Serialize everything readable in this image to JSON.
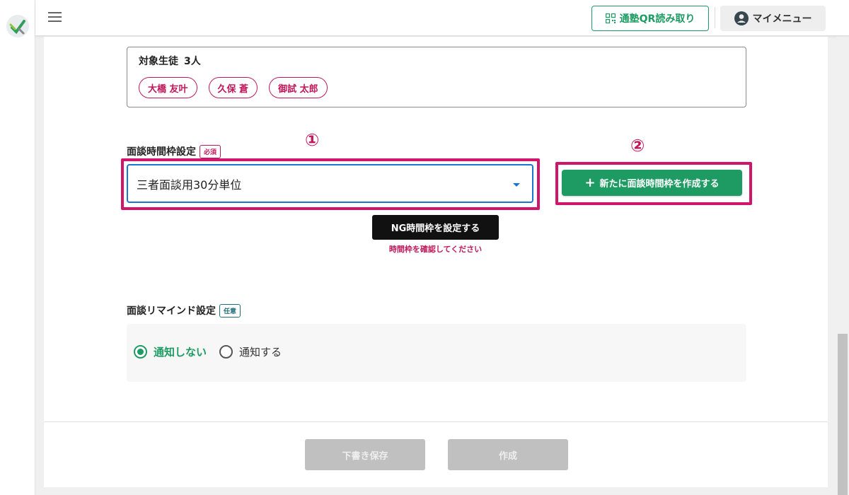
{
  "header": {
    "qr_button_label": "通塾QR読み取り",
    "my_menu_label": "マイメニュー"
  },
  "students": {
    "title": "対象生徒",
    "count": "3人",
    "chips": [
      "大橋 友叶",
      "久保 蒼",
      "御試 太郎"
    ]
  },
  "time_frame": {
    "label": "面談時間枠設定",
    "badge": "必須",
    "marker_1": "①",
    "marker_2": "②",
    "selected_value": "三者面談用30分単位",
    "create_button_label": "新たに面談時間枠を作成する",
    "ng_button_label": "NG時間枠を設定する",
    "error_text": "時間枠を確認してください"
  },
  "remind": {
    "label": "面談リマインド設定",
    "badge": "任意",
    "options": [
      {
        "label": "通知しない",
        "selected": true
      },
      {
        "label": "通知する",
        "selected": false
      }
    ]
  },
  "footer": {
    "draft_label": "下書き保存",
    "create_label": "作成"
  },
  "colors": {
    "accent_green": "#1e9b63",
    "highlight_magenta": "#d0166b",
    "required_red": "#c2185b",
    "select_blue": "#1976d2"
  }
}
